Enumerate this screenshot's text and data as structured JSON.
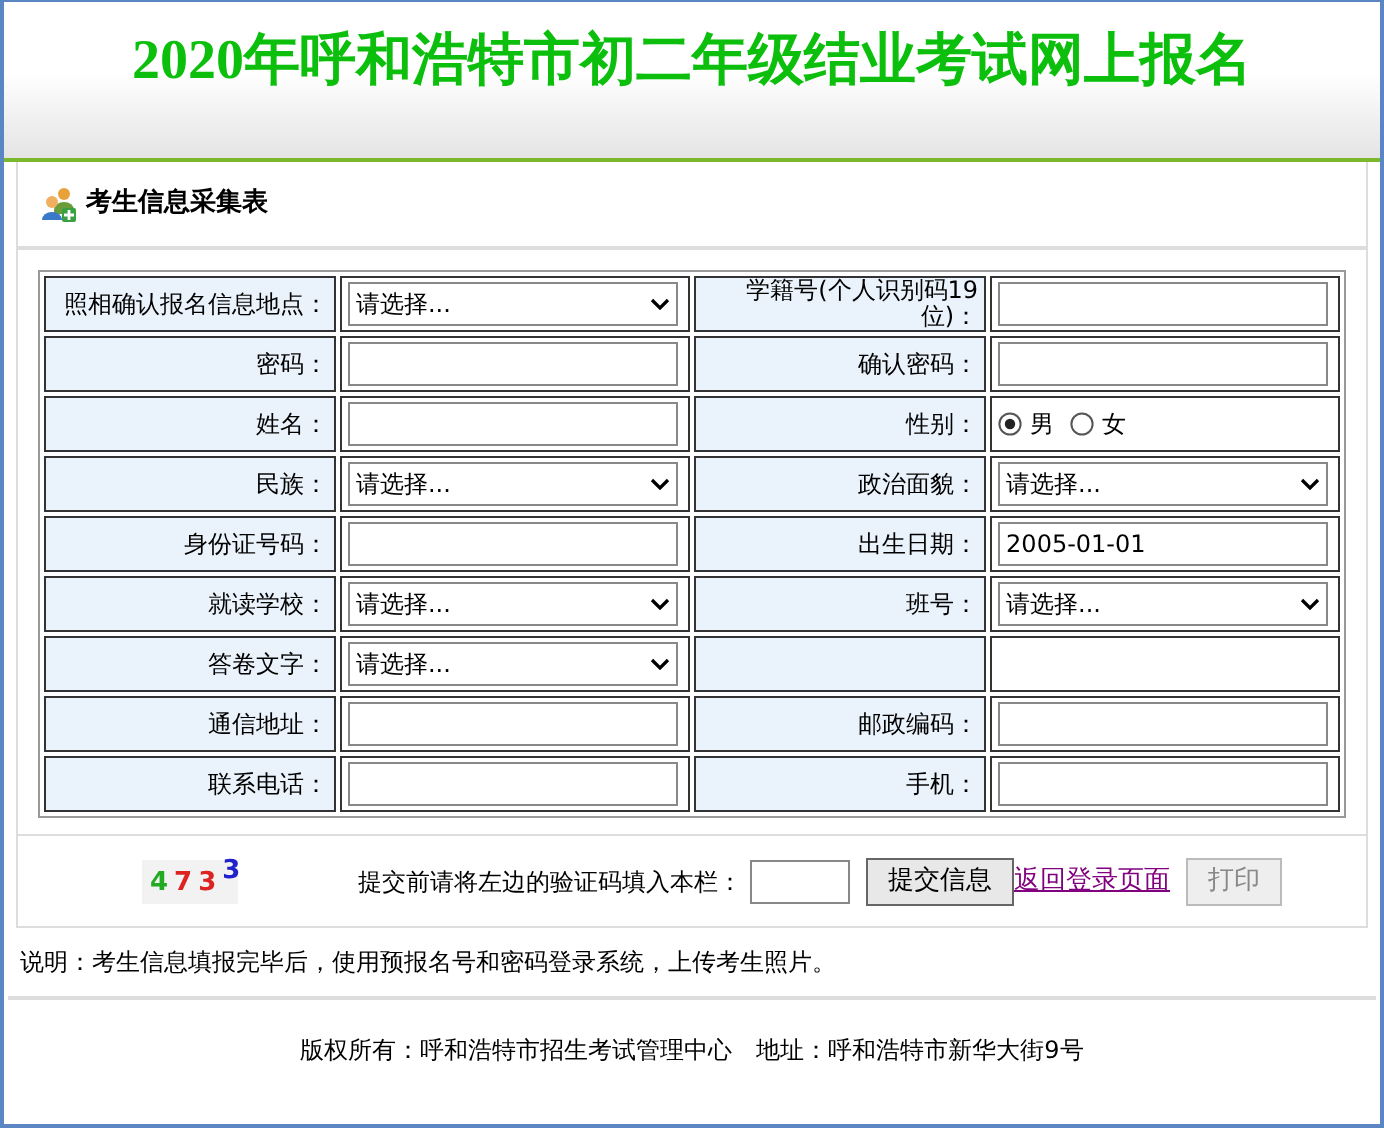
{
  "title": "2020年呼和浩特市初二年级结业考试网上报名",
  "panel_title": "考生信息采集表",
  "rows": [
    [
      {
        "label": "照相确认报名信息地点：",
        "kind": "select",
        "value": "请选择..."
      },
      {
        "label": "学籍号(个人识别码19位)：",
        "kind": "text"
      }
    ],
    [
      {
        "label": "密码：",
        "kind": "text"
      },
      {
        "label": "确认密码：",
        "kind": "text"
      }
    ],
    [
      {
        "label": "姓名：",
        "kind": "text"
      },
      {
        "label": "性别：",
        "kind": "radio",
        "options": [
          {
            "label": "男",
            "selected": true
          },
          {
            "label": "女",
            "selected": false
          }
        ]
      }
    ],
    [
      {
        "label": "民族：",
        "kind": "select",
        "value": "请选择..."
      },
      {
        "label": "政治面貌：",
        "kind": "select",
        "value": "请选择..."
      }
    ],
    [
      {
        "label": "身份证号码：",
        "kind": "text"
      },
      {
        "label": "出生日期：",
        "kind": "text",
        "value": "2005-01-01"
      }
    ],
    [
      {
        "label": "就读学校：",
        "kind": "select",
        "value": "请选择..."
      },
      {
        "label": "班号：",
        "kind": "select",
        "value": "请选择..."
      }
    ],
    [
      {
        "label": "答卷文字：",
        "kind": "select",
        "value": "请选择..."
      },
      {
        "kind": "empty"
      }
    ],
    [
      {
        "label": "通信地址：",
        "kind": "text"
      },
      {
        "label": "邮政编码：",
        "kind": "text"
      }
    ],
    [
      {
        "label": "联系电话：",
        "kind": "text"
      },
      {
        "label": "手机：",
        "kind": "text"
      }
    ]
  ],
  "captcha": [
    {
      "char": "4",
      "color": "#22aa22"
    },
    {
      "char": "7",
      "color": "#dd2222"
    },
    {
      "char": "3",
      "color": "#dd2222"
    },
    {
      "char": "3",
      "color": "#2222cc"
    }
  ],
  "captcha_prompt": "提交前请将左边的验证码填入本栏：",
  "submit_button": "提交信息",
  "back_link": "返回登录页面",
  "print_button": {
    "label": "打印",
    "disabled": true
  },
  "note": "说明：考生信息填报完毕后，使用预报名号和密码登录系统，上传考生照片。",
  "footer": "版权所有：呼和浩特市招生考试管理中心　地址：呼和浩特市新华大街9号"
}
